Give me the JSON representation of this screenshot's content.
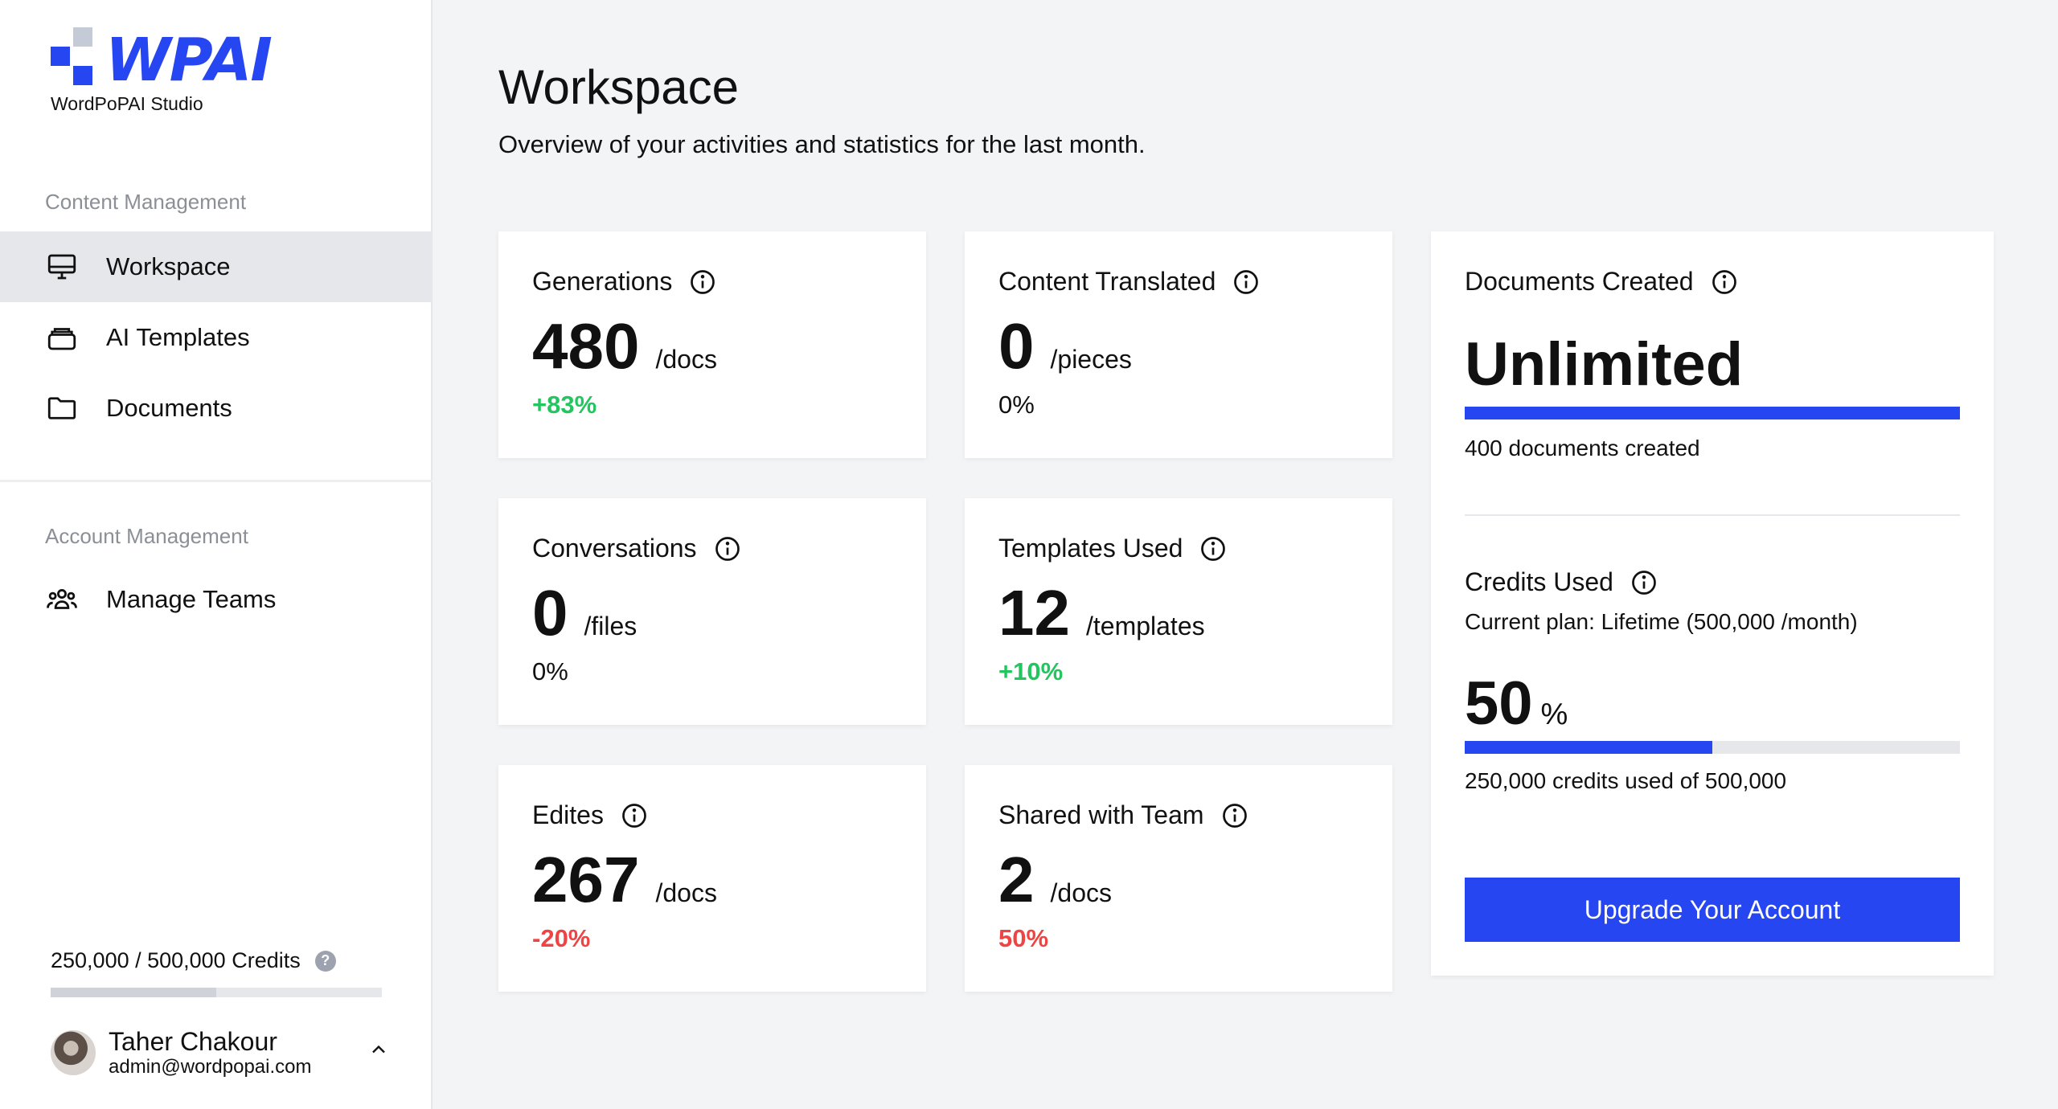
{
  "brand": {
    "logo_text": "WPAI",
    "subtitle": "WordPoPAI Studio",
    "colors": {
      "primary": "#2546f0",
      "square_light": "#c5cbd6"
    }
  },
  "sidebar": {
    "content_section": "Content Management",
    "account_section": "Account Management",
    "items": [
      {
        "label": "Workspace",
        "icon": "monitor-icon",
        "active": true
      },
      {
        "label": "AI Templates",
        "icon": "layers-icon",
        "active": false
      },
      {
        "label": "Documents",
        "icon": "folder-icon",
        "active": false
      },
      {
        "label": "Manage Teams",
        "icon": "team-icon",
        "active": false
      }
    ],
    "credits": {
      "label": "250,000 / 500,000 Credits",
      "help": "?",
      "used_fraction": 0.5
    },
    "user": {
      "name": "Taher Chakour",
      "email": "admin@wordpopai.com"
    }
  },
  "header": {
    "title": "Workspace",
    "subtitle": "Overview of your activities and statistics for the last month."
  },
  "stats": [
    {
      "title": "Generations",
      "value": "480",
      "unit": "/docs",
      "change": "+83%",
      "trend": "pos"
    },
    {
      "title": "Content Translated",
      "value": "0",
      "unit": "/pieces",
      "change": "0%",
      "trend": "neu"
    },
    {
      "title": "Conversations",
      "value": "0",
      "unit": "/files",
      "change": "0%",
      "trend": "neu"
    },
    {
      "title": "Templates Used",
      "value": "12",
      "unit": "/templates",
      "change": "+10%",
      "trend": "pos"
    },
    {
      "title": "Edites",
      "value": "267",
      "unit": "/docs",
      "change": "-20%",
      "trend": "neg"
    },
    {
      "title": "Shared with Team",
      "value": "2",
      "unit": "/docs",
      "change": "50%",
      "trend": "neg"
    }
  ],
  "summary": {
    "documents_title": "Documents Created",
    "documents_value": "Unlimited",
    "documents_text": "400 documents created",
    "credits_title": "Credits Used",
    "plan_text": "Current plan: Lifetime (500,000 /month)",
    "percent_value": "50",
    "percent_sign": "%",
    "credits_fraction": 0.5,
    "credits_text": "250,000 credits used of 500,000",
    "upgrade_label": "Upgrade Your Account"
  }
}
